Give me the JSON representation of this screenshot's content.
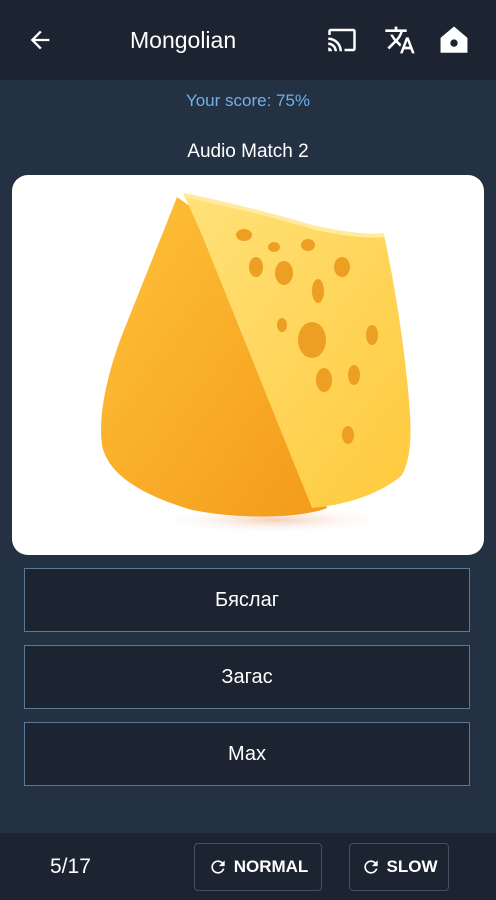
{
  "appbar": {
    "back_icon": "arrow-left-icon",
    "title": "Mongolian",
    "cast_icon": "cast-icon",
    "translate_icon": "translate-icon",
    "home_icon": "home-icon"
  },
  "score_text": "Your score: 75%",
  "quiz_title": "Audio Match 2",
  "image": {
    "subject": "cheese wedge",
    "colors": {
      "cheese_light": "#ffd24a",
      "cheese_dark": "#f2a21a",
      "hole": "#e59a1a"
    }
  },
  "answers": [
    {
      "label": "Бяслаг"
    },
    {
      "label": "Загас"
    },
    {
      "label": "Мах"
    }
  ],
  "bottombar": {
    "progress": "5/17",
    "normal_label": "NORMAL",
    "slow_label": "SLOW",
    "replay_icon": "replay-icon"
  },
  "colors": {
    "background": "#243142",
    "bar": "#1b2430",
    "score": "#6fb1e8",
    "answer_border": "#5c7894"
  }
}
